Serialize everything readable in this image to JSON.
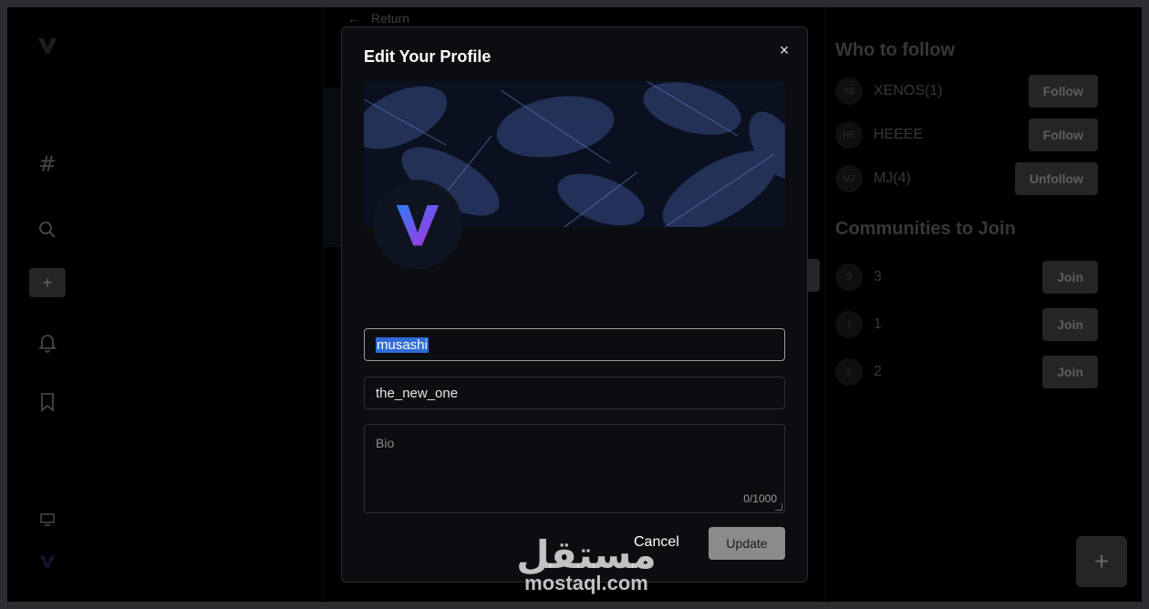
{
  "nav": {
    "return_label": "Return"
  },
  "sidebar": {
    "icons": [
      "logo-v-icon",
      "hash-icon",
      "search-icon",
      "plus-icon",
      "bell-icon",
      "bookmark-icon",
      "monitor-icon",
      "avatar-v-icon"
    ],
    "create_label": "+"
  },
  "who_to_follow": {
    "title": "Who to follow",
    "users": [
      {
        "initials": "XE",
        "name": "XENOS(1)",
        "action": "Follow"
      },
      {
        "initials": "HE",
        "name": "HEEEE",
        "action": "Follow"
      },
      {
        "initials": "MJ",
        "name": "MJ(4)",
        "action": "Unfollow"
      }
    ]
  },
  "communities": {
    "title": "Communities to Join",
    "items": [
      {
        "initials": "3",
        "name": "3",
        "action": "Join"
      },
      {
        "initials": "1",
        "name": "1",
        "action": "Join"
      },
      {
        "initials": "2",
        "name": "2",
        "action": "Join"
      }
    ]
  },
  "fab": {
    "label": "+"
  },
  "modal": {
    "title": "Edit Your Profile",
    "close_label": "×",
    "display_name": "musashi",
    "username": "the_new_one",
    "bio_placeholder": "Bio",
    "bio_count": "0/1000",
    "cancel_label": "Cancel",
    "update_label": "Update"
  },
  "watermark": {
    "arabic": "مستقل",
    "latin": "mostaql.com"
  },
  "colors": {
    "page_bg": "#000000",
    "modal_bg": "#0c0d10",
    "button_grey": "#4a4a4a",
    "selection": "#2f6ad6",
    "logo_gradient_start": "#2f7cf6",
    "logo_gradient_end": "#b02fe0"
  }
}
